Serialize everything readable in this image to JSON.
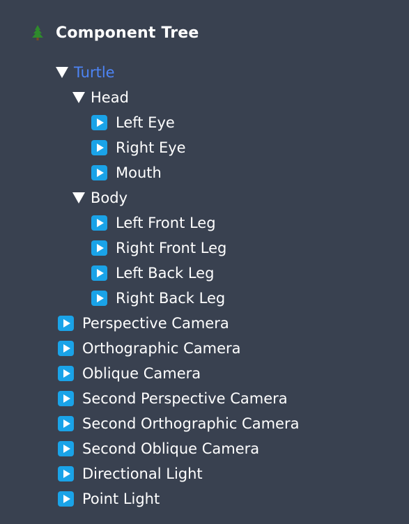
{
  "header": {
    "icon": "evergreen-tree-icon",
    "title": "Component Tree"
  },
  "tree": {
    "turtle": "Turtle",
    "head": "Head",
    "left_eye": "Left Eye",
    "right_eye": "Right Eye",
    "mouth": "Mouth",
    "body": "Body",
    "left_front_leg": "Left Front Leg",
    "right_front_leg": "Right Front Leg",
    "left_back_leg": "Left Back Leg",
    "right_back_leg": "Right Back Leg",
    "perspective_camera": "Perspective Camera",
    "orthographic_camera": "Orthographic Camera",
    "oblique_camera": "Oblique Camera",
    "second_perspective_camera": "Second Perspective Camera",
    "second_orthographic_camera": "Second Orthographic Camera",
    "second_oblique_camera": "Second Oblique Camera",
    "directional_light": "Directional Light",
    "point_light": "Point Light"
  },
  "colors": {
    "background": "#394150",
    "selected_text": "#4d84f5",
    "play_icon": "#1aa3e8",
    "text": "#ffffff"
  }
}
